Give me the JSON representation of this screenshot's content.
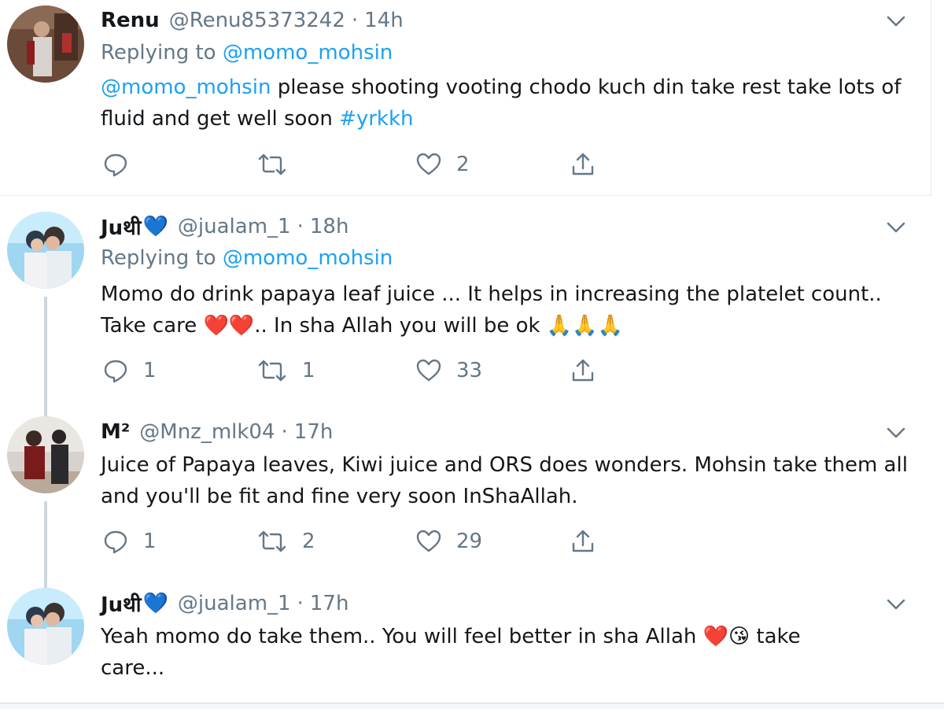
{
  "tweets": [
    {
      "name": "Renu",
      "name_badge": "",
      "handle": "@Renu85373242",
      "separator": "·",
      "time": "14h",
      "replying_prefix": "Replying to",
      "replying_to": "@momo_mohsin",
      "text_mention": "@momo_mohsin",
      "text_body": " please shooting vooting chodo kuch din take rest take lots of fluid and get well soon ",
      "text_hashtag": "#yrkkh",
      "replies": "",
      "retweets": "",
      "likes": "2"
    },
    {
      "name": "Juथी",
      "name_badge": "💙",
      "handle": "@jualam_1",
      "separator": "·",
      "time": "18h",
      "replying_prefix": "Replying to",
      "replying_to": "@momo_mohsin",
      "text_body": "Momo do drink papaya leaf juice ... It helps in increasing the platelet count.. Take care ❤️❤️.. In sha Allah you will be ok 🙏🙏🙏",
      "replies": "1",
      "retweets": "1",
      "likes": "33"
    },
    {
      "name": "M²",
      "handle": "@Mnz_mlk04",
      "separator": "·",
      "time": "17h",
      "text_body": "Juice of Papaya leaves, Kiwi juice and ORS does wonders. Mohsin take them all and you'll be fit and fine very soon InShaAllah.",
      "replies": "1",
      "retweets": "2",
      "likes": "29"
    },
    {
      "name": "Juथी",
      "name_badge": "💙",
      "handle": "@jualam_1",
      "separator": "·",
      "time": "17h",
      "text_body": "Yeah momo do take them..  You will  feel better in sha Allah ❤️😘 take care..."
    }
  ],
  "colors": {
    "link": "#1da1f2",
    "muted": "#657786",
    "text": "#14171a",
    "thread_line": "#ccd6dd",
    "divider": "#e6ecf0"
  },
  "icons": [
    "chevron-down-icon",
    "reply-icon",
    "retweet-icon",
    "like-icon",
    "share-icon"
  ]
}
